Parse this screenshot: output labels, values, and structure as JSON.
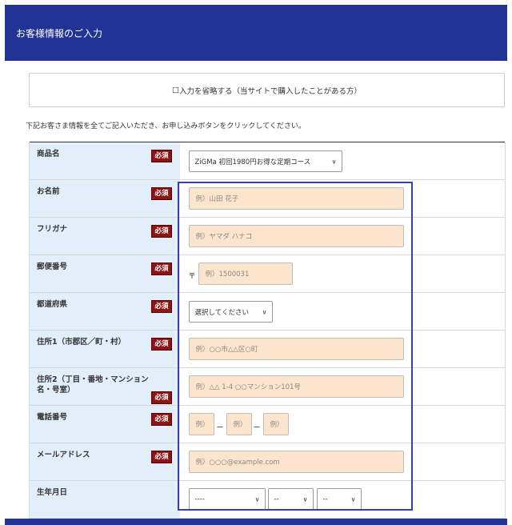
{
  "header": {
    "title": "お客様情報のご入力"
  },
  "skip": {
    "checkbox": "□",
    "label": "入力を省略する（当サイトで購入したことがある方）"
  },
  "instruction": "下記お客さま情報を全てご記入いただき、お申し込みボタンをクリックしてください。",
  "required_label": "必須",
  "form": {
    "product": {
      "label": "商品名",
      "value": "ZiGMa 初回1980円お得な定期コース"
    },
    "name": {
      "label": "お名前",
      "placeholder": "例）山田 花子"
    },
    "kana": {
      "label": "フリガナ",
      "placeholder": "例）ヤマダ ハナコ"
    },
    "postal": {
      "label": "郵便番号",
      "mark": "〒",
      "placeholder": "例）1500031"
    },
    "prefecture": {
      "label": "都道府県",
      "value": "選択してください"
    },
    "address1": {
      "label": "住所1（市郡区／町・村）",
      "placeholder": "例）○○市△△区○町"
    },
    "address2": {
      "label": "住所2（丁目・番地・マンション名・号室）",
      "placeholder": "例）△△ 1-4 ○○マンション101号"
    },
    "phone": {
      "label": "電話番号",
      "placeholder1": "例）",
      "placeholder2": "例）",
      "placeholder3": "例）",
      "separator": "ー"
    },
    "email": {
      "label": "メールアドレス",
      "placeholder": "例）○○○@example.com"
    },
    "birthday": {
      "label": "生年月日",
      "year": "----",
      "month": "--",
      "day": "--"
    }
  },
  "colors": {
    "header_bg": "#213394",
    "label_bg": "#e3eefb",
    "input_bg": "#fce5cc",
    "required_bg": "#8c1414",
    "highlight": "#3b3fae"
  }
}
